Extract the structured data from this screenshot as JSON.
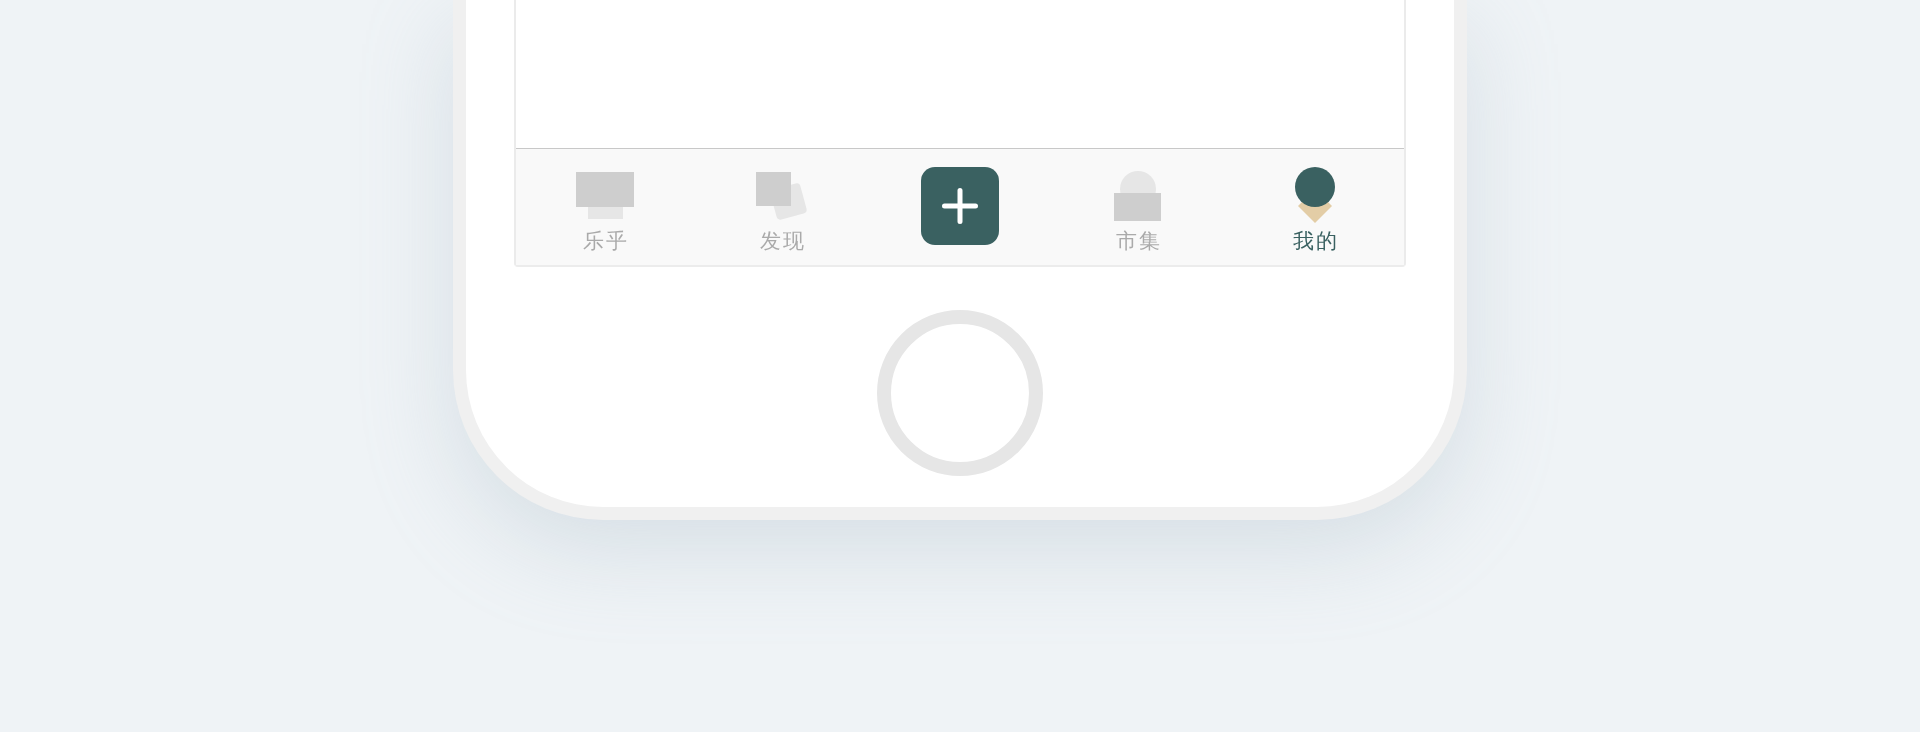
{
  "tab_bar": {
    "tabs": [
      {
        "kind": "feed",
        "label": "乐乎",
        "selected": false
      },
      {
        "kind": "discover",
        "label": "发现",
        "selected": false
      },
      {
        "kind": "add",
        "selected": false
      },
      {
        "kind": "market",
        "label": "市集",
        "selected": false
      },
      {
        "kind": "profile",
        "label": "我的",
        "selected": true
      }
    ]
  }
}
